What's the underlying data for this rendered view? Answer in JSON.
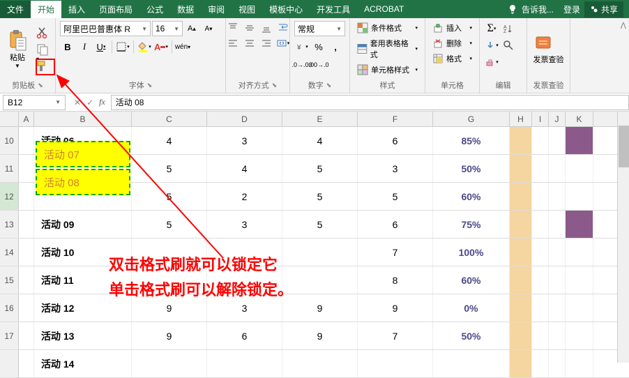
{
  "tabs": {
    "file": "文件",
    "home": "开始",
    "insert": "插入",
    "layout": "页面布局",
    "formulas": "公式",
    "data": "数据",
    "review": "审阅",
    "view": "视图",
    "template": "模板中心",
    "dev": "开发工具",
    "acrobat": "ACROBAT"
  },
  "titlebar": {
    "tell_me": "告诉我...",
    "login": "登录",
    "share": "共享"
  },
  "ribbon": {
    "clipboard": {
      "label": "剪贴板",
      "paste": "粘贴"
    },
    "font": {
      "label": "字体",
      "name": "阿里巴巴普惠体 R",
      "size": "16"
    },
    "alignment": {
      "label": "对齐方式"
    },
    "number": {
      "label": "数字",
      "format": "常规"
    },
    "styles": {
      "label": "样式",
      "conditional": "条件格式",
      "table": "套用表格格式",
      "cell": "单元格样式"
    },
    "cells": {
      "label": "单元格",
      "insert": "插入",
      "delete": "删除",
      "format": "格式"
    },
    "editing": {
      "label": "编辑"
    },
    "invoice": {
      "label": "发票查验",
      "btn": "发票查验"
    }
  },
  "formula_bar": {
    "name_box": "B12",
    "formula": "活动 08"
  },
  "columns": [
    "A",
    "B",
    "C",
    "D",
    "E",
    "F",
    "G",
    "H",
    "I",
    "J",
    "K"
  ],
  "rows": [
    {
      "num": "10",
      "b": "活动 06",
      "c": "4",
      "d": "3",
      "e": "4",
      "f": "6",
      "g": "85%"
    },
    {
      "num": "11",
      "b": "活动 07",
      "c": "5",
      "d": "4",
      "e": "5",
      "f": "3",
      "g": "50%",
      "yellow": true
    },
    {
      "num": "12",
      "b": "活动 08",
      "c": "5",
      "d": "2",
      "e": "5",
      "f": "5",
      "g": "60%",
      "yellow": true,
      "active": true
    },
    {
      "num": "13",
      "b": "活动 09",
      "c": "5",
      "d": "3",
      "e": "5",
      "f": "6",
      "g": "75%"
    },
    {
      "num": "14",
      "b": "活动 10",
      "c": "",
      "d": "",
      "e": "",
      "f": "7",
      "g": "100%"
    },
    {
      "num": "15",
      "b": "活动 11",
      "c": "",
      "d": "",
      "e": "",
      "f": "8",
      "g": "60%"
    },
    {
      "num": "16",
      "b": "活动 12",
      "c": "9",
      "d": "3",
      "e": "9",
      "f": "9",
      "g": "0%"
    },
    {
      "num": "17",
      "b": "活动 13",
      "c": "9",
      "d": "6",
      "e": "9",
      "f": "7",
      "g": "50%"
    },
    {
      "num": "",
      "b": "活动 14",
      "c": "",
      "d": "",
      "e": "",
      "f": "",
      "g": ""
    }
  ],
  "annotation": {
    "line1": "双击格式刷就可以锁定它",
    "line2": "单击格式刷可以解除锁定。"
  }
}
